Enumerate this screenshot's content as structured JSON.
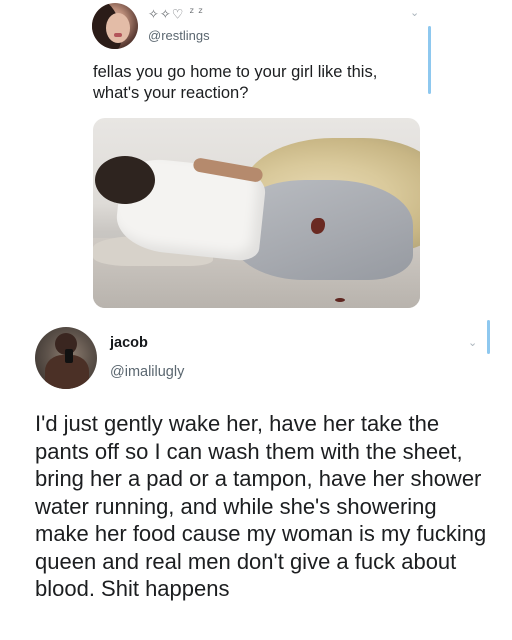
{
  "tweet1": {
    "emoji_line": "✧✧♡",
    "emoji_sleep": "z z",
    "handle": "@restlings",
    "text": "fellas you go home to your girl like this, what's your reaction?",
    "menu_icon": "chevron-down-icon"
  },
  "photo": {
    "alt_subject": "image"
  },
  "tweet2": {
    "name": "jacob",
    "handle": "@imalilugly",
    "text": "I'd just gently wake her, have her take the pants off so I can wash them with the sheet, bring her a pad or a tampon, have her shower water running, and while she's showering make her food cause my woman is my fucking queen and real men don't give a fuck about blood. Shit happens",
    "menu_icon": "chevron-down-icon"
  },
  "colors": {
    "thread_line": "#8ec8ef",
    "text": "#1c1e20",
    "secondary_text": "#5b6770"
  }
}
